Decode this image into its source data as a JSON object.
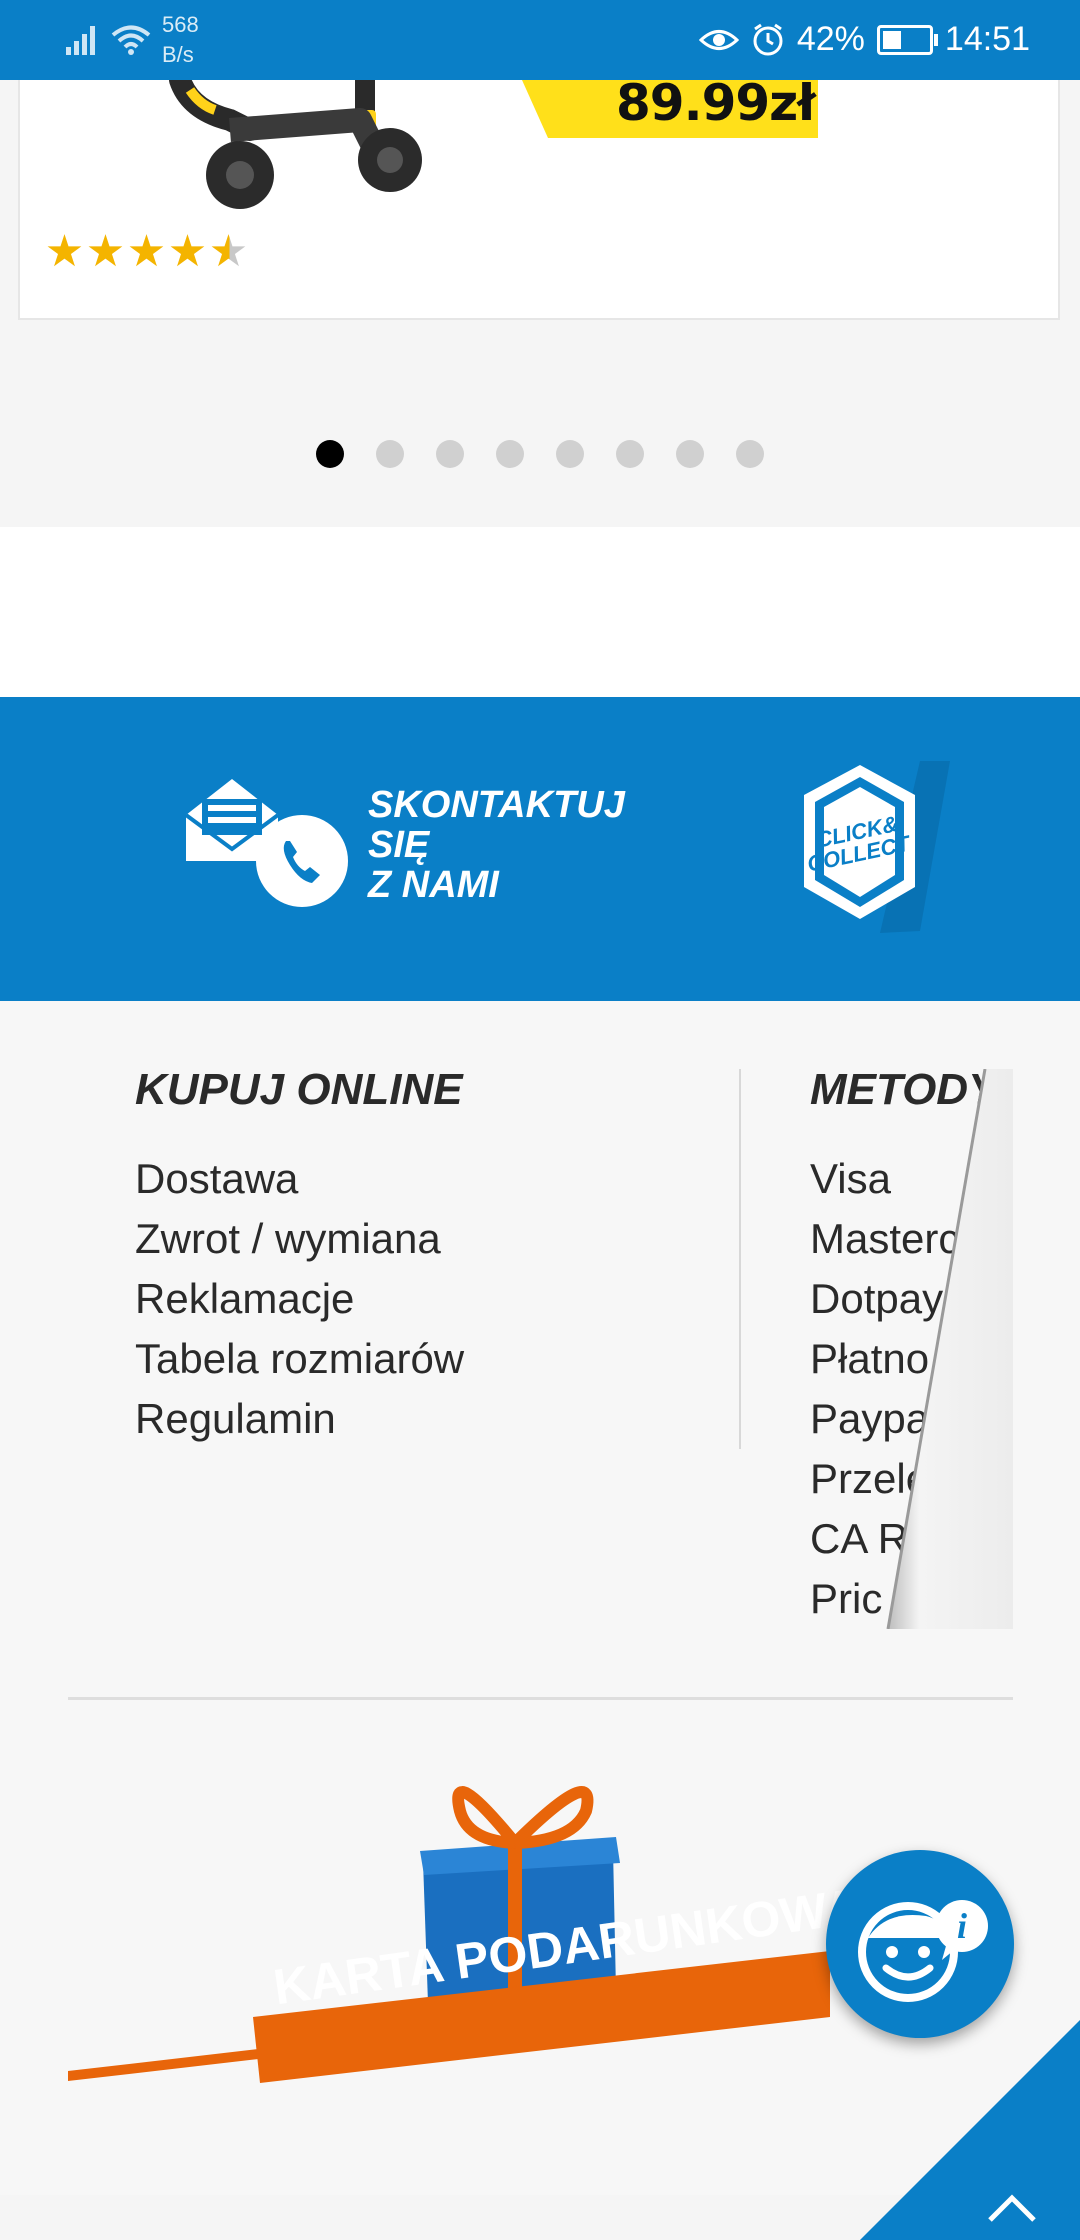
{
  "status_bar": {
    "network_speed_value": "568",
    "network_speed_unit": "B/s",
    "battery": "42%",
    "battery_level": 0.42,
    "time": "14:51",
    "icons": [
      "signal-icon",
      "wifi-icon",
      "eye-icon",
      "alarm-icon",
      "battery-icon"
    ]
  },
  "product": {
    "price": "89.99zł",
    "rating": 4.5,
    "rating_max": 5
  },
  "carousel": {
    "page_count": 8,
    "active_index": 0
  },
  "contact_banner": {
    "line1": "SKONTAKTUJ",
    "line2": "SIĘ",
    "line3": "Z NAMI",
    "badge_text": "CLICK & COLLECT"
  },
  "footer": {
    "col1_title": "KUPUJ ONLINE",
    "col1_links": [
      "Dostawa",
      "Zwrot / wymiana",
      "Reklamacje",
      "Tabela rozmiarów",
      "Regulamin"
    ],
    "col2_title": "METODY",
    "col2_links": [
      "Visa",
      "Masterc",
      "Dotpay",
      "Płatno",
      "Paypa",
      "Przele",
      "CA R",
      "Pric"
    ]
  },
  "gift_card": {
    "label": "KARTA PODARUNKOWA"
  },
  "colors": {
    "brand_blue": "#0a7fc7",
    "price_yellow": "#ffe01a",
    "gift_orange": "#e8650a",
    "star_gold": "#f4b400"
  }
}
